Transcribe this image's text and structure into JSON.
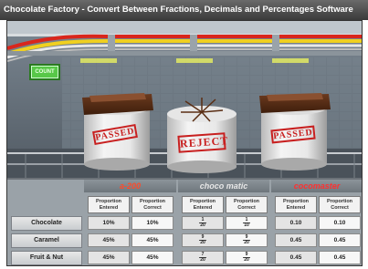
{
  "window": {
    "title": "Chocolate Factory - Convert Between Fractions, Decimals and Percentages Software"
  },
  "counter": {
    "label": "COUNT"
  },
  "scene": {
    "barrels": [
      {
        "status": "PASSED"
      },
      {
        "status": "REJECT"
      },
      {
        "status": "PASSED"
      }
    ]
  },
  "machines": [
    {
      "name": "a-200",
      "color": "#ff4a2a"
    },
    {
      "name": "choco matic",
      "color": "#e8e8e8"
    },
    {
      "name": "cocomaster",
      "color": "#ff3030"
    }
  ],
  "table": {
    "col_entered": "Proportion Entered",
    "col_correct": "Proportion Correct",
    "rows": [
      {
        "label": "Chocolate",
        "m1": {
          "entered": "10%",
          "correct": "10%"
        },
        "m2": {
          "entered": {
            "num": "1",
            "den": "20"
          },
          "correct": {
            "num": "1",
            "den": "10"
          }
        },
        "m3": {
          "entered": "0.10",
          "correct": "0.10"
        }
      },
      {
        "label": "Caramel",
        "m1": {
          "entered": "45%",
          "correct": "45%"
        },
        "m2": {
          "entered": {
            "num": "9",
            "den": "20"
          },
          "correct": {
            "num": "9",
            "den": "20"
          }
        },
        "m3": {
          "entered": "0.45",
          "correct": "0.45"
        }
      },
      {
        "label": "Fruit & Nut",
        "m1": {
          "entered": "45%",
          "correct": "45%"
        },
        "m2": {
          "entered": {
            "num": "7",
            "den": "20"
          },
          "correct": {
            "num": "9",
            "den": "20"
          }
        },
        "m3": {
          "entered": "0.45",
          "correct": "0.45"
        }
      }
    ]
  }
}
